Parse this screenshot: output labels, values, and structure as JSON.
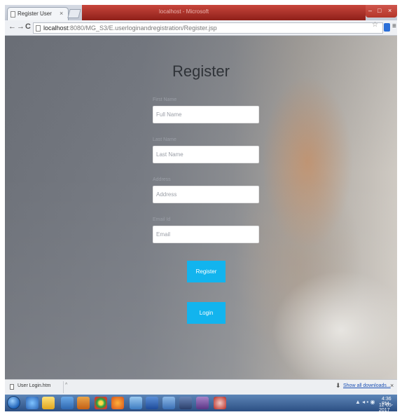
{
  "browser": {
    "window_title": "localhost - Microsoft",
    "tab_label": "Register User",
    "tab_close": "×",
    "url_host": "localhost",
    "url_path": ":8080/MG_S3/E.userloginandregistration/Register.jsp",
    "nav_back": "←",
    "nav_forward": "→",
    "reload": "C",
    "bookmark_star": "☆",
    "menu_glyph": "≡",
    "win_minimize": "–",
    "win_maximize": "□",
    "win_close": "×"
  },
  "page": {
    "title": "Register",
    "fields": [
      {
        "label": "First Name",
        "placeholder": "Full Name"
      },
      {
        "label": "Last Name",
        "placeholder": "Last Name"
      },
      {
        "label": "Address",
        "placeholder": "Address"
      },
      {
        "label": "Email Id",
        "placeholder": "Email"
      }
    ],
    "register_button": "Register",
    "login_button": "Login"
  },
  "download_bar": {
    "file_name": "User Login.htm",
    "caret": "^",
    "arrow": "⬇",
    "show_all": "Show all downloads...",
    "close": "×"
  },
  "taskbar": {
    "tray_icons": "▲ ◂ ▪ ◉",
    "clock_time": "4:36 PM",
    "clock_date": "12-05-2017"
  },
  "colors": {
    "accent_button": "#12b4ee",
    "title_bar_red": "#b43529",
    "taskbar_blue": "#2c4f83"
  },
  "icons": [
    "document-icon",
    "back-arrow-icon",
    "forward-arrow-icon",
    "reload-icon",
    "star-icon",
    "extension-icon",
    "menu-icon",
    "download-icon",
    "windows-start-icon"
  ]
}
